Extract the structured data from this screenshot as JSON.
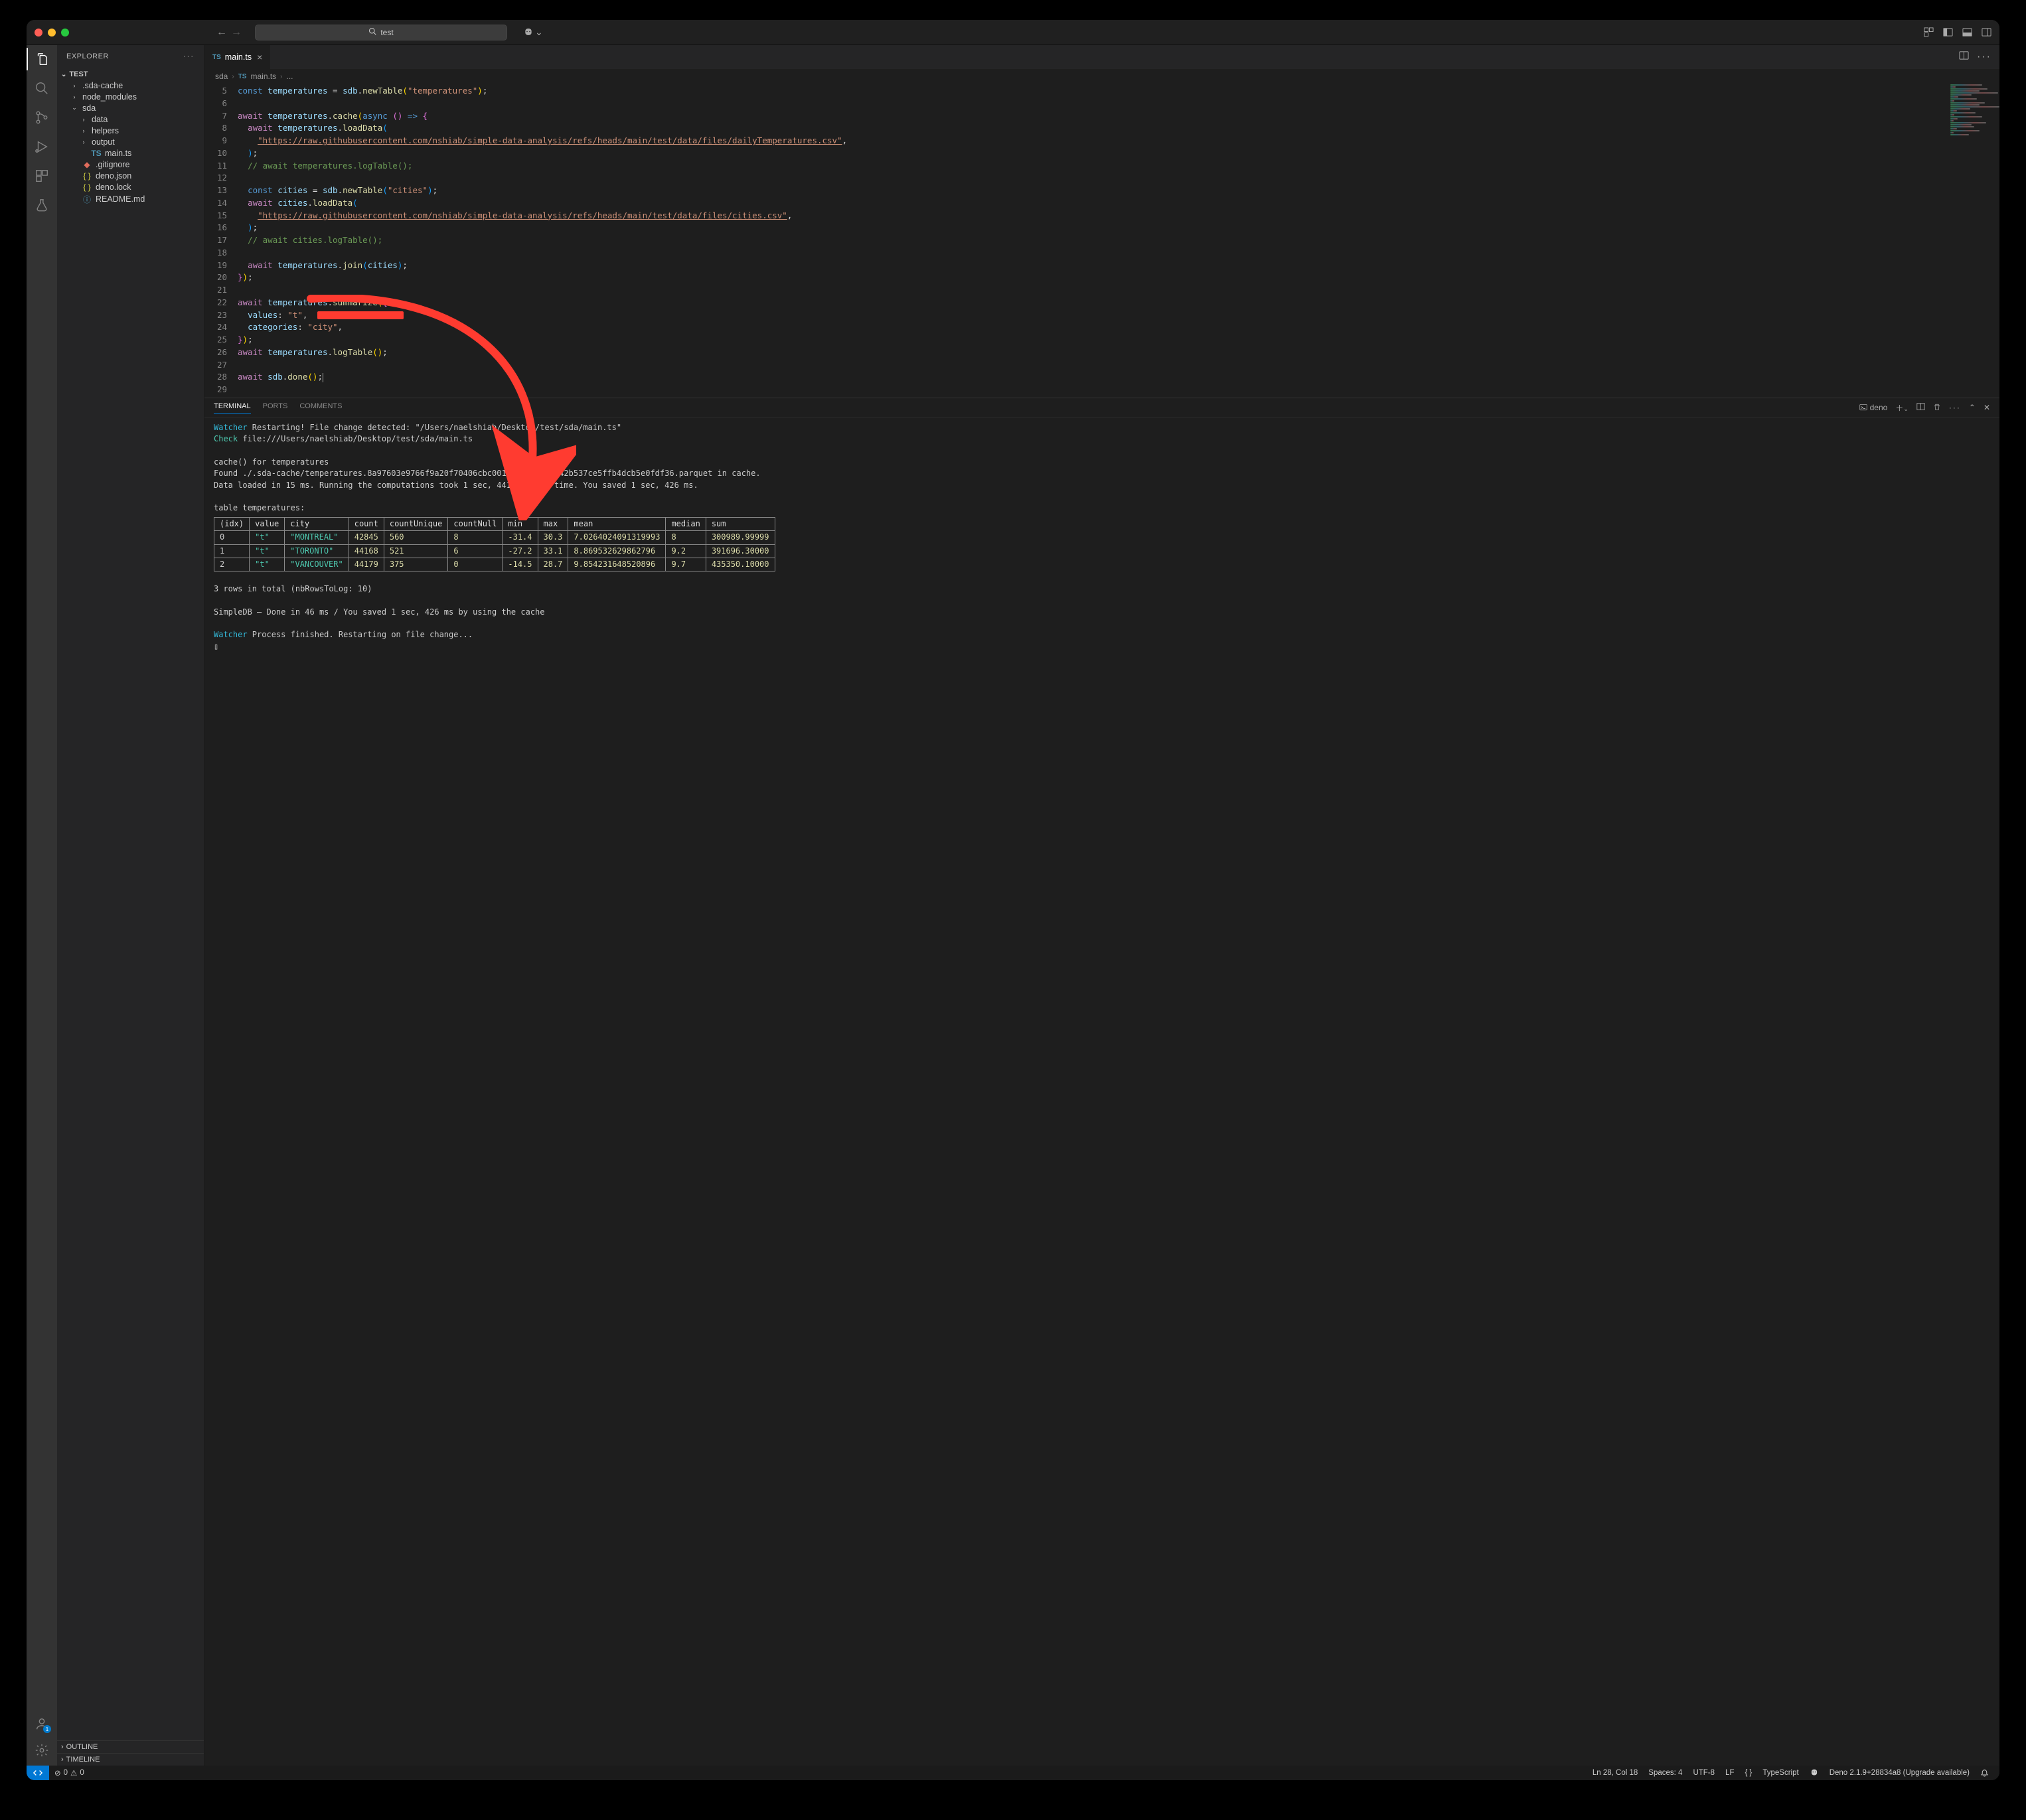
{
  "titlebar": {
    "search_text": "test",
    "copilot_caret": "⌄"
  },
  "sidebar": {
    "title": "EXPLORER",
    "root": "TEST",
    "tree": [
      {
        "type": "folder",
        "name": ".sda-cache",
        "open": false,
        "indent": 1
      },
      {
        "type": "folder",
        "name": "node_modules",
        "open": false,
        "indent": 1
      },
      {
        "type": "folder",
        "name": "sda",
        "open": true,
        "indent": 1
      },
      {
        "type": "folder",
        "name": "data",
        "open": false,
        "indent": 2
      },
      {
        "type": "folder",
        "name": "helpers",
        "open": false,
        "indent": 2
      },
      {
        "type": "folder",
        "name": "output",
        "open": false,
        "indent": 2
      },
      {
        "type": "file",
        "name": "main.ts",
        "icon": "ts",
        "indent": 2
      },
      {
        "type": "file",
        "name": ".gitignore",
        "icon": "git",
        "indent": 1
      },
      {
        "type": "file",
        "name": "deno.json",
        "icon": "json",
        "indent": 1
      },
      {
        "type": "file",
        "name": "deno.lock",
        "icon": "json",
        "indent": 1
      },
      {
        "type": "file",
        "name": "README.md",
        "icon": "info",
        "indent": 1
      }
    ],
    "outline": "OUTLINE",
    "timeline": "TIMELINE"
  },
  "accounts_badge": "1",
  "tab": {
    "filename": "main.ts"
  },
  "breadcrumb": {
    "a": "sda",
    "b": "main.ts",
    "c": "..."
  },
  "line_numbers": [
    "5",
    "6",
    "7",
    "8",
    "9",
    "10",
    "11",
    "12",
    "13",
    "14",
    "15",
    "16",
    "17",
    "18",
    "19",
    "20",
    "21",
    "22",
    "23",
    "24",
    "25",
    "26",
    "27",
    "28",
    "29"
  ],
  "code": {
    "l5": {
      "kw": "const",
      "id": " temperatures ",
      "op": "= ",
      "obj": "sdb",
      "dot": ".",
      "fn": "newTable",
      "p1": "(",
      "str": "\"temperatures\"",
      "p2": ")",
      "semi": ";"
    },
    "l7": {
      "kw": "await",
      "id": " temperatures",
      "dot": ".",
      "fn": "cache",
      "p1": "(",
      "kw2": "async ",
      "p2": "()",
      "arrow": " => ",
      "brace": "{"
    },
    "l8": {
      "kw": "await",
      "id": " temperatures",
      "dot": ".",
      "fn": "loadData",
      "p1": "("
    },
    "l9": {
      "url": "\"https://raw.githubusercontent.com/nshiab/simple-data-analysis/refs/heads/main/test/data/files/dailyTemperatures.csv\"",
      "comma": ","
    },
    "l10": {
      "p": ")",
      "semi": ";"
    },
    "l11": {
      "cmt": "// await temperatures.logTable();"
    },
    "l13": {
      "kw": "const",
      "id": " cities ",
      "op": "= ",
      "obj": "sdb",
      "dot": ".",
      "fn": "newTable",
      "p1": "(",
      "str": "\"cities\"",
      "p2": ")",
      "semi": ";"
    },
    "l14": {
      "kw": "await",
      "id": " cities",
      "dot": ".",
      "fn": "loadData",
      "p1": "("
    },
    "l15": {
      "url": "\"https://raw.githubusercontent.com/nshiab/simple-data-analysis/refs/heads/main/test/data/files/cities.csv\"",
      "comma": ","
    },
    "l16": {
      "p": ")",
      "semi": ";"
    },
    "l17": {
      "cmt": "// await cities.logTable();"
    },
    "l19": {
      "kw": "await",
      "id": " temperatures",
      "dot": ".",
      "fn": "join",
      "p1": "(",
      "arg": "cities",
      "p2": ")",
      "semi": ";"
    },
    "l20": {
      "brace": "}",
      "p": ")",
      "semi": ";"
    },
    "l22": {
      "kw": "await",
      "id": " temperatures",
      "dot": ".",
      "fn": "summarize",
      "p1": "(",
      "brace": "{"
    },
    "l23": {
      "prop": "values",
      "colon": ": ",
      "str": "\"t\"",
      "comma": ","
    },
    "l24": {
      "prop": "categories",
      "colon": ": ",
      "str": "\"city\"",
      "comma": ","
    },
    "l25": {
      "brace": "}",
      "p": ")",
      "semi": ";"
    },
    "l26": {
      "kw": "await",
      "id": " temperatures",
      "dot": ".",
      "fn": "logTable",
      "p1": "()",
      "semi": ";"
    },
    "l28": {
      "kw": "await",
      "id": " sdb",
      "dot": ".",
      "fn": "done",
      "p1": "()",
      "semi": ";"
    }
  },
  "panel": {
    "tabs": {
      "terminal": "TERMINAL",
      "ports": "PORTS",
      "comments": "COMMENTS"
    },
    "runner": "deno",
    "log": {
      "l1a": "Watcher",
      "l1b": " Restarting! File change detected: \"/Users/naelshiab/Desktop/test/sda/main.ts\"",
      "l2a": "Check",
      "l2b": " file:///Users/naelshiab/Desktop/test/sda/main.ts",
      "l4": "cache() for temperatures",
      "l5": "Found ./.sda-cache/temperatures.8a97603e9766f9a20f70406cbc001e1ed2b24ea642b537ce5ffb4dcb5e0fdf36.parquet in cache.",
      "l6": "Data loaded in 15 ms. Running the computations took 1 sec, 441 ms last time. You saved 1 sec, 426 ms.",
      "l8": "table temperatures:",
      "rows_footer": "3 rows in total (nbRowsToLog: 10)",
      "done": "SimpleDB – Done in 46 ms / You saved 1 sec, 426 ms by using the cache",
      "w2a": "Watcher",
      "w2b": " Process finished. Restarting on file change...",
      "prompt": "▯"
    },
    "table": {
      "headers": [
        "(idx)",
        "value",
        "city",
        "count",
        "countUnique",
        "countNull",
        "min",
        "max",
        "mean",
        "median",
        "sum"
      ],
      "rows": [
        [
          "0",
          "\"t\"",
          "\"MONTREAL\"",
          "42845",
          "560",
          "8",
          "-31.4",
          "30.3",
          "7.0264024091319993",
          "8",
          "300989.99999"
        ],
        [
          "1",
          "\"t\"",
          "\"TORONTO\"",
          "44168",
          "521",
          "6",
          "-27.2",
          "33.1",
          "8.869532629862796",
          "9.2",
          "391696.30000"
        ],
        [
          "2",
          "\"t\"",
          "\"VANCOUVER\"",
          "44179",
          "375",
          "0",
          "-14.5",
          "28.7",
          "9.854231648520896",
          "9.7",
          "435350.10000"
        ]
      ]
    }
  },
  "status": {
    "errors": "0",
    "warnings": "0",
    "pos": "Ln 28, Col 18",
    "spaces": "Spaces: 4",
    "enc": "UTF-8",
    "eol": "LF",
    "curly": "{ }",
    "lang": "TypeScript",
    "deno": "Deno 2.1.9+28834a8 (Upgrade available)"
  }
}
